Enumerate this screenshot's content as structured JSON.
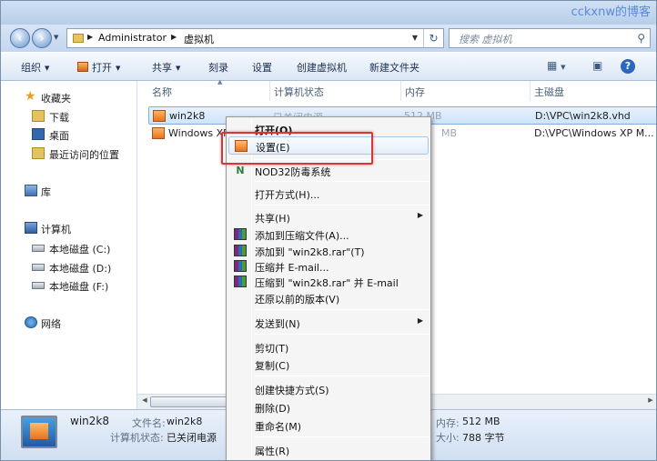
{
  "watermark": "cckxnw的博客",
  "address": {
    "crumbs": [
      "Administrator",
      "虚拟机"
    ],
    "search_placeholder": "搜索 虚拟机"
  },
  "toolbar": {
    "organize": "组织",
    "open": "打开",
    "share": "共享",
    "burn": "刻录",
    "settings": "设置",
    "create_vm": "创建虚拟机",
    "new_folder": "新建文件夹"
  },
  "sidebar": {
    "favorites": "收藏夹",
    "downloads": "下载",
    "desktop": "桌面",
    "recent": "最近访问的位置",
    "libraries": "库",
    "computer": "计算机",
    "drive_c": "本地磁盘 (C:)",
    "drive_d": "本地磁盘 (D:)",
    "drive_f": "本地磁盘 (F:)",
    "network": "网络"
  },
  "columns": [
    "名称",
    "计算机状态",
    "内存",
    "主磁盘"
  ],
  "files": [
    {
      "name": "win2k8",
      "state": "已关闭电源",
      "memory": "512 MB",
      "disk": "D:\\VPC\\win2k8.vhd"
    },
    {
      "name": "Windows XP Mode",
      "state": "",
      "memory": "MB",
      "disk": "D:\\VPC\\Windows XP M..."
    }
  ],
  "details": {
    "name": "win2k8",
    "filename_label": "文件名:",
    "filename_value": "win2k8",
    "state_label": "计算机状态:",
    "state_value": "已关闭电源",
    "memory_label": "内存:",
    "memory_value": "512 MB",
    "size_label": "大小:",
    "size_value": "788 字节"
  },
  "context_menu": {
    "open": "打开(O)",
    "settings": "设置(E)",
    "nod32": "NOD32防毒系统",
    "open_with": "打开方式(H)...",
    "share": "共享(H)",
    "add_archive": "添加到压缩文件(A)...",
    "add_rar": "添加到 \"win2k8.rar\"(T)",
    "compress_email": "压缩并 E-mail...",
    "compress_rar_email": "压缩到 \"win2k8.rar\" 并 E-mail",
    "restore": "还原以前的版本(V)",
    "send_to": "发送到(N)",
    "cut": "剪切(T)",
    "copy": "复制(C)",
    "shortcut": "创建快捷方式(S)",
    "delete": "删除(D)",
    "rename": "重命名(M)",
    "properties": "属性(R)"
  }
}
